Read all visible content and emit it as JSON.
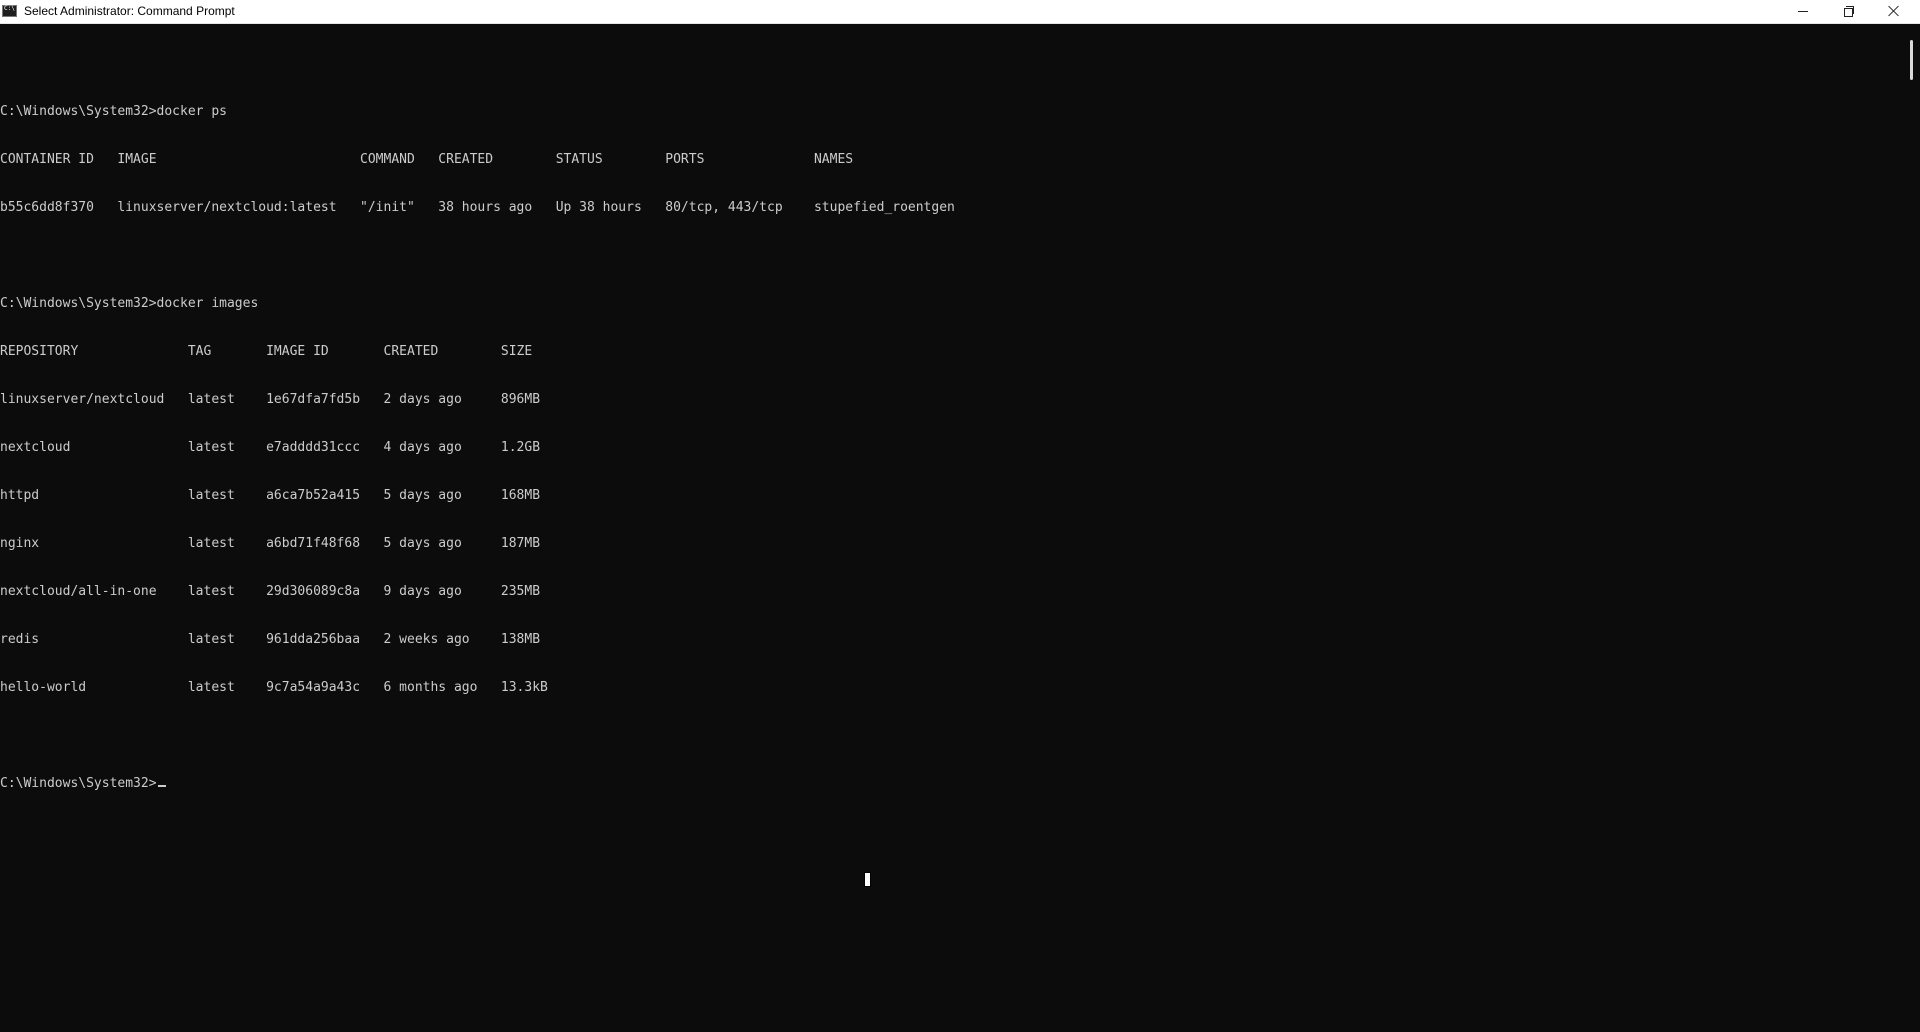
{
  "window": {
    "title": "Select Administrator: Command Prompt",
    "icon": "cmd-icon",
    "controls": {
      "minimize": "minimize-icon",
      "maximize": "restore-icon",
      "close": "close-icon"
    }
  },
  "console": {
    "lines": [
      "",
      "C:\\Windows\\System32>docker ps",
      "CONTAINER ID   IMAGE                          COMMAND   CREATED        STATUS        PORTS              NAMES",
      "b55c6dd8f370   linuxserver/nextcloud:latest   \"/init\"   38 hours ago   Up 38 hours   80/tcp, 443/tcp    stupefied_roentgen",
      "",
      "C:\\Windows\\System32>docker images",
      "REPOSITORY              TAG       IMAGE ID       CREATED        SIZE",
      "linuxserver/nextcloud   latest    1e67dfa7fd5b   2 days ago     896MB",
      "nextcloud               latest    e7adddd31ccc   4 days ago     1.2GB",
      "httpd                   latest    a6ca7b52a415   5 days ago     168MB",
      "nginx                   latest    a6bd71f48f68   5 days ago     187MB",
      "nextcloud/all-in-one    latest    29d306089c8a   9 days ago     235MB",
      "redis                   latest    961dda256baa   2 weeks ago    138MB",
      "hello-world             latest    9c7a54a9a43c   6 months ago   13.3kB",
      ""
    ],
    "prompt": "C:\\Windows\\System32>"
  },
  "colors": {
    "background": "#0c0c0c",
    "foreground": "#cccccc",
    "titlebar": "#ffffff"
  }
}
